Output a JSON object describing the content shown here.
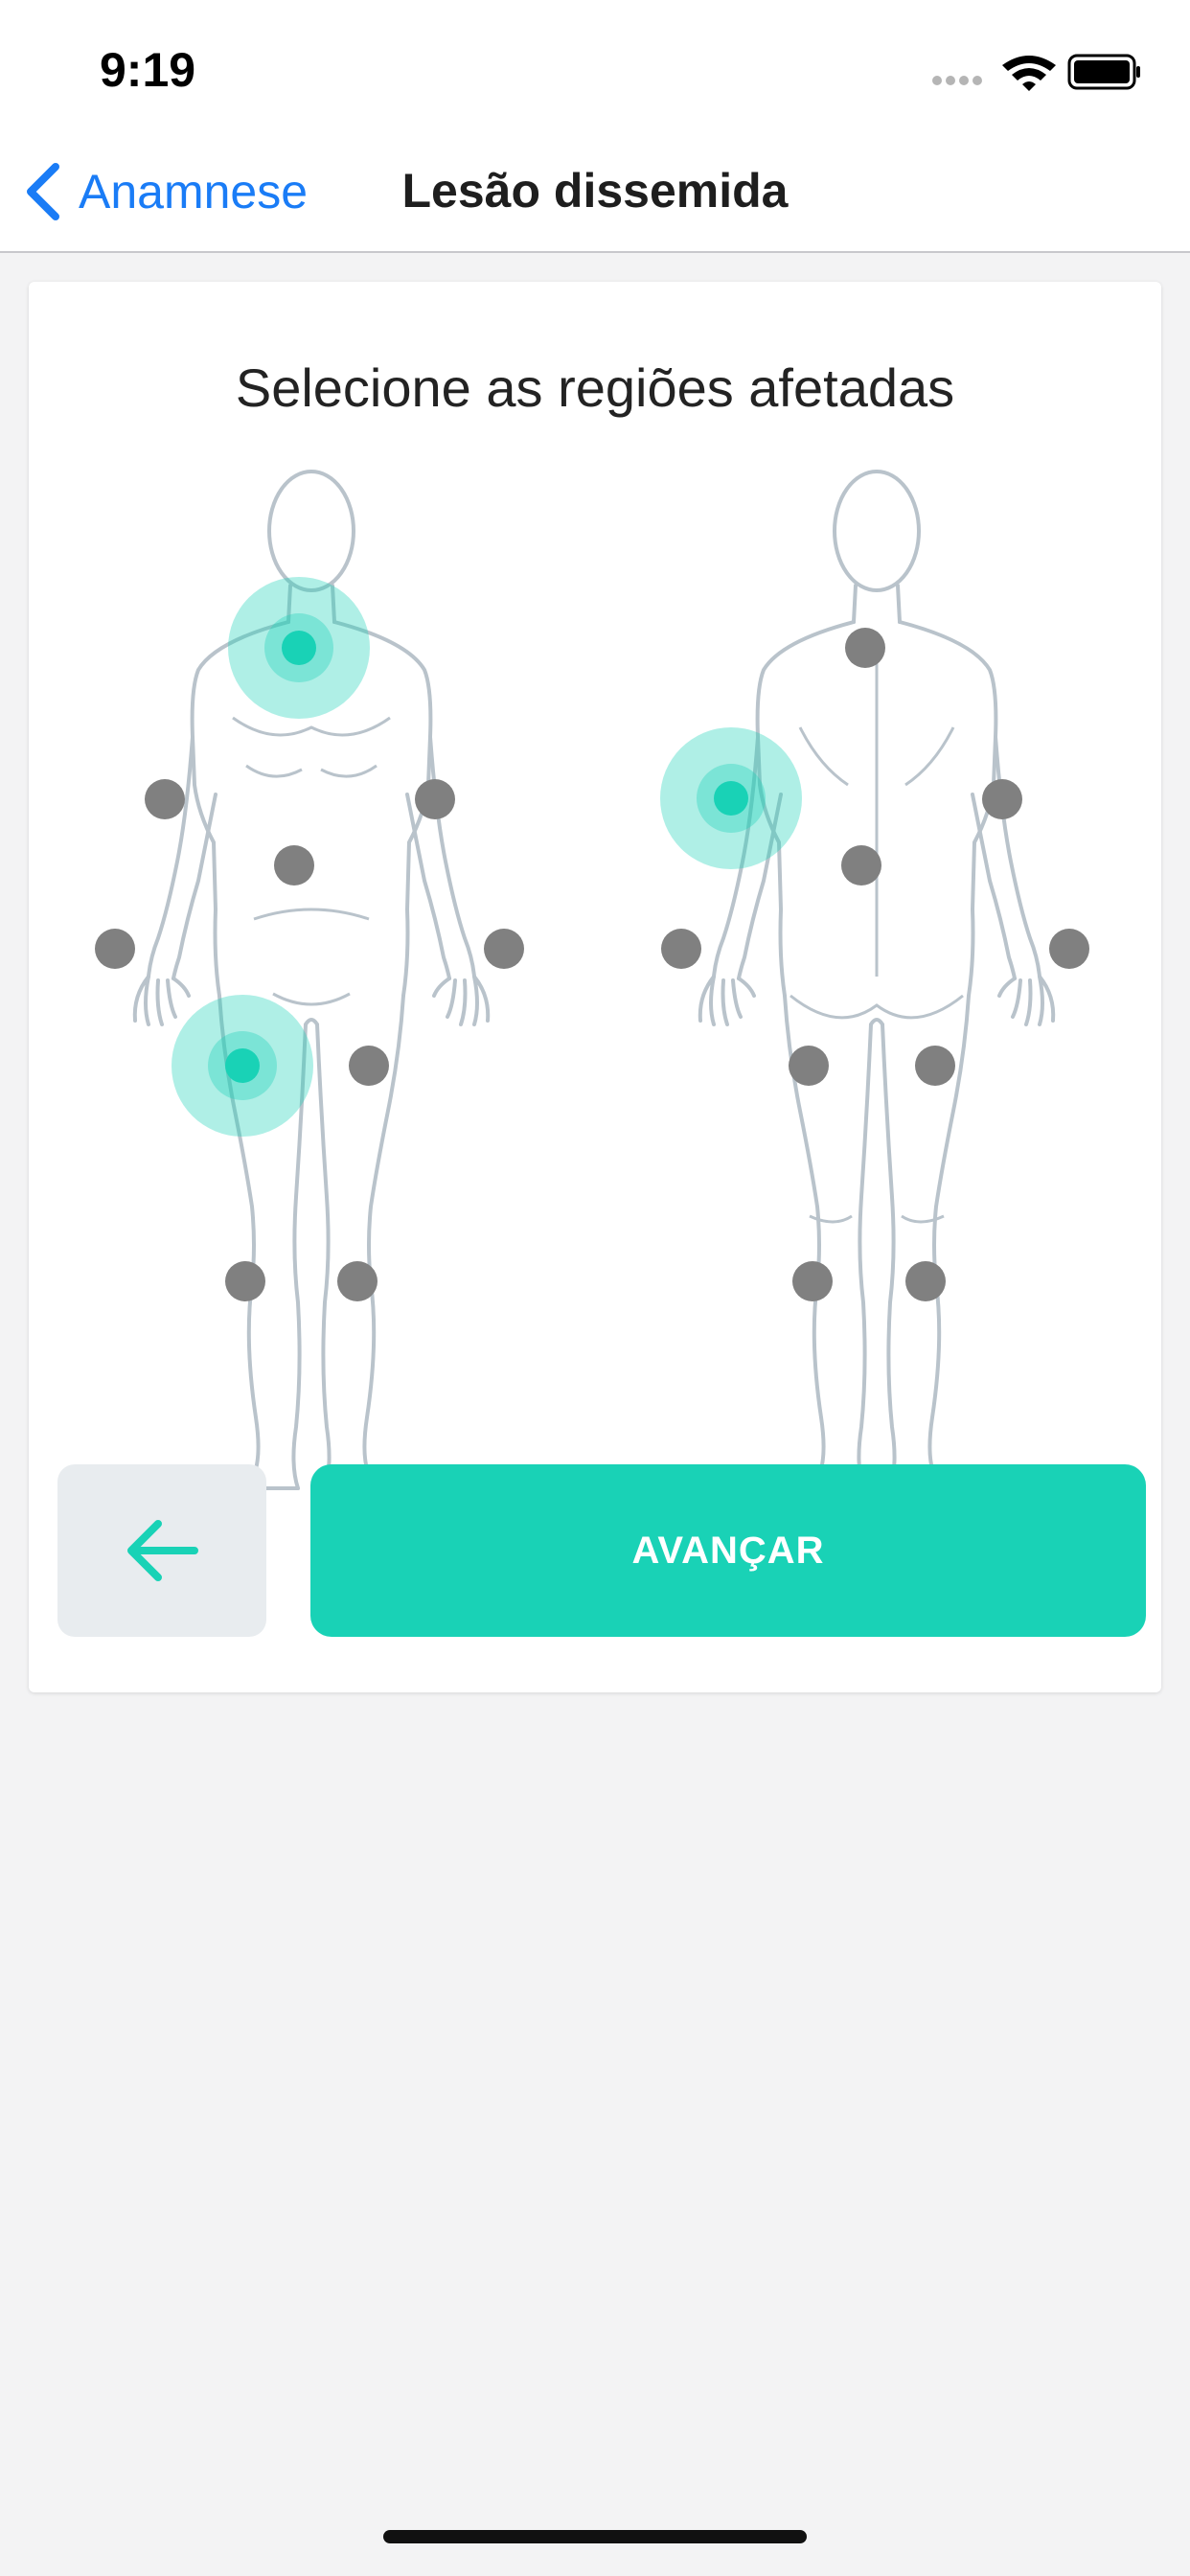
{
  "status_bar": {
    "time": "9:19",
    "icons": [
      "signal-icon",
      "wifi-icon",
      "battery-icon"
    ]
  },
  "nav": {
    "back_label": "Anamnese",
    "title": "Lesão dissemida"
  },
  "card": {
    "title": "Selecione as regiões afetadas",
    "front_points": [
      {
        "region": "neck",
        "selected": true
      },
      {
        "region": "right-upper-arm",
        "selected": false
      },
      {
        "region": "left-upper-arm",
        "selected": false
      },
      {
        "region": "abdomen",
        "selected": false
      },
      {
        "region": "right-hand",
        "selected": false
      },
      {
        "region": "left-hand",
        "selected": false
      },
      {
        "region": "right-thigh",
        "selected": true
      },
      {
        "region": "left-thigh",
        "selected": false
      },
      {
        "region": "right-lower-leg",
        "selected": false
      },
      {
        "region": "left-lower-leg",
        "selected": false
      }
    ],
    "back_points": [
      {
        "region": "nape",
        "selected": false
      },
      {
        "region": "left-shoulder-back",
        "selected": true
      },
      {
        "region": "right-upper-arm-back",
        "selected": false
      },
      {
        "region": "lower-back",
        "selected": false
      },
      {
        "region": "left-hand-back",
        "selected": false
      },
      {
        "region": "right-hand-back",
        "selected": false
      },
      {
        "region": "left-thigh-back",
        "selected": false
      },
      {
        "region": "right-thigh-back",
        "selected": false
      },
      {
        "region": "left-calf",
        "selected": false
      },
      {
        "region": "right-calf",
        "selected": false
      }
    ]
  },
  "buttons": {
    "advance_label": "AVANÇAR",
    "back_icon": "arrow-left-icon"
  },
  "colors": {
    "accent": "#19d2b6",
    "link": "#1a7cf6",
    "point_idle": "#808080",
    "selected_halo": "#9be9dc"
  }
}
